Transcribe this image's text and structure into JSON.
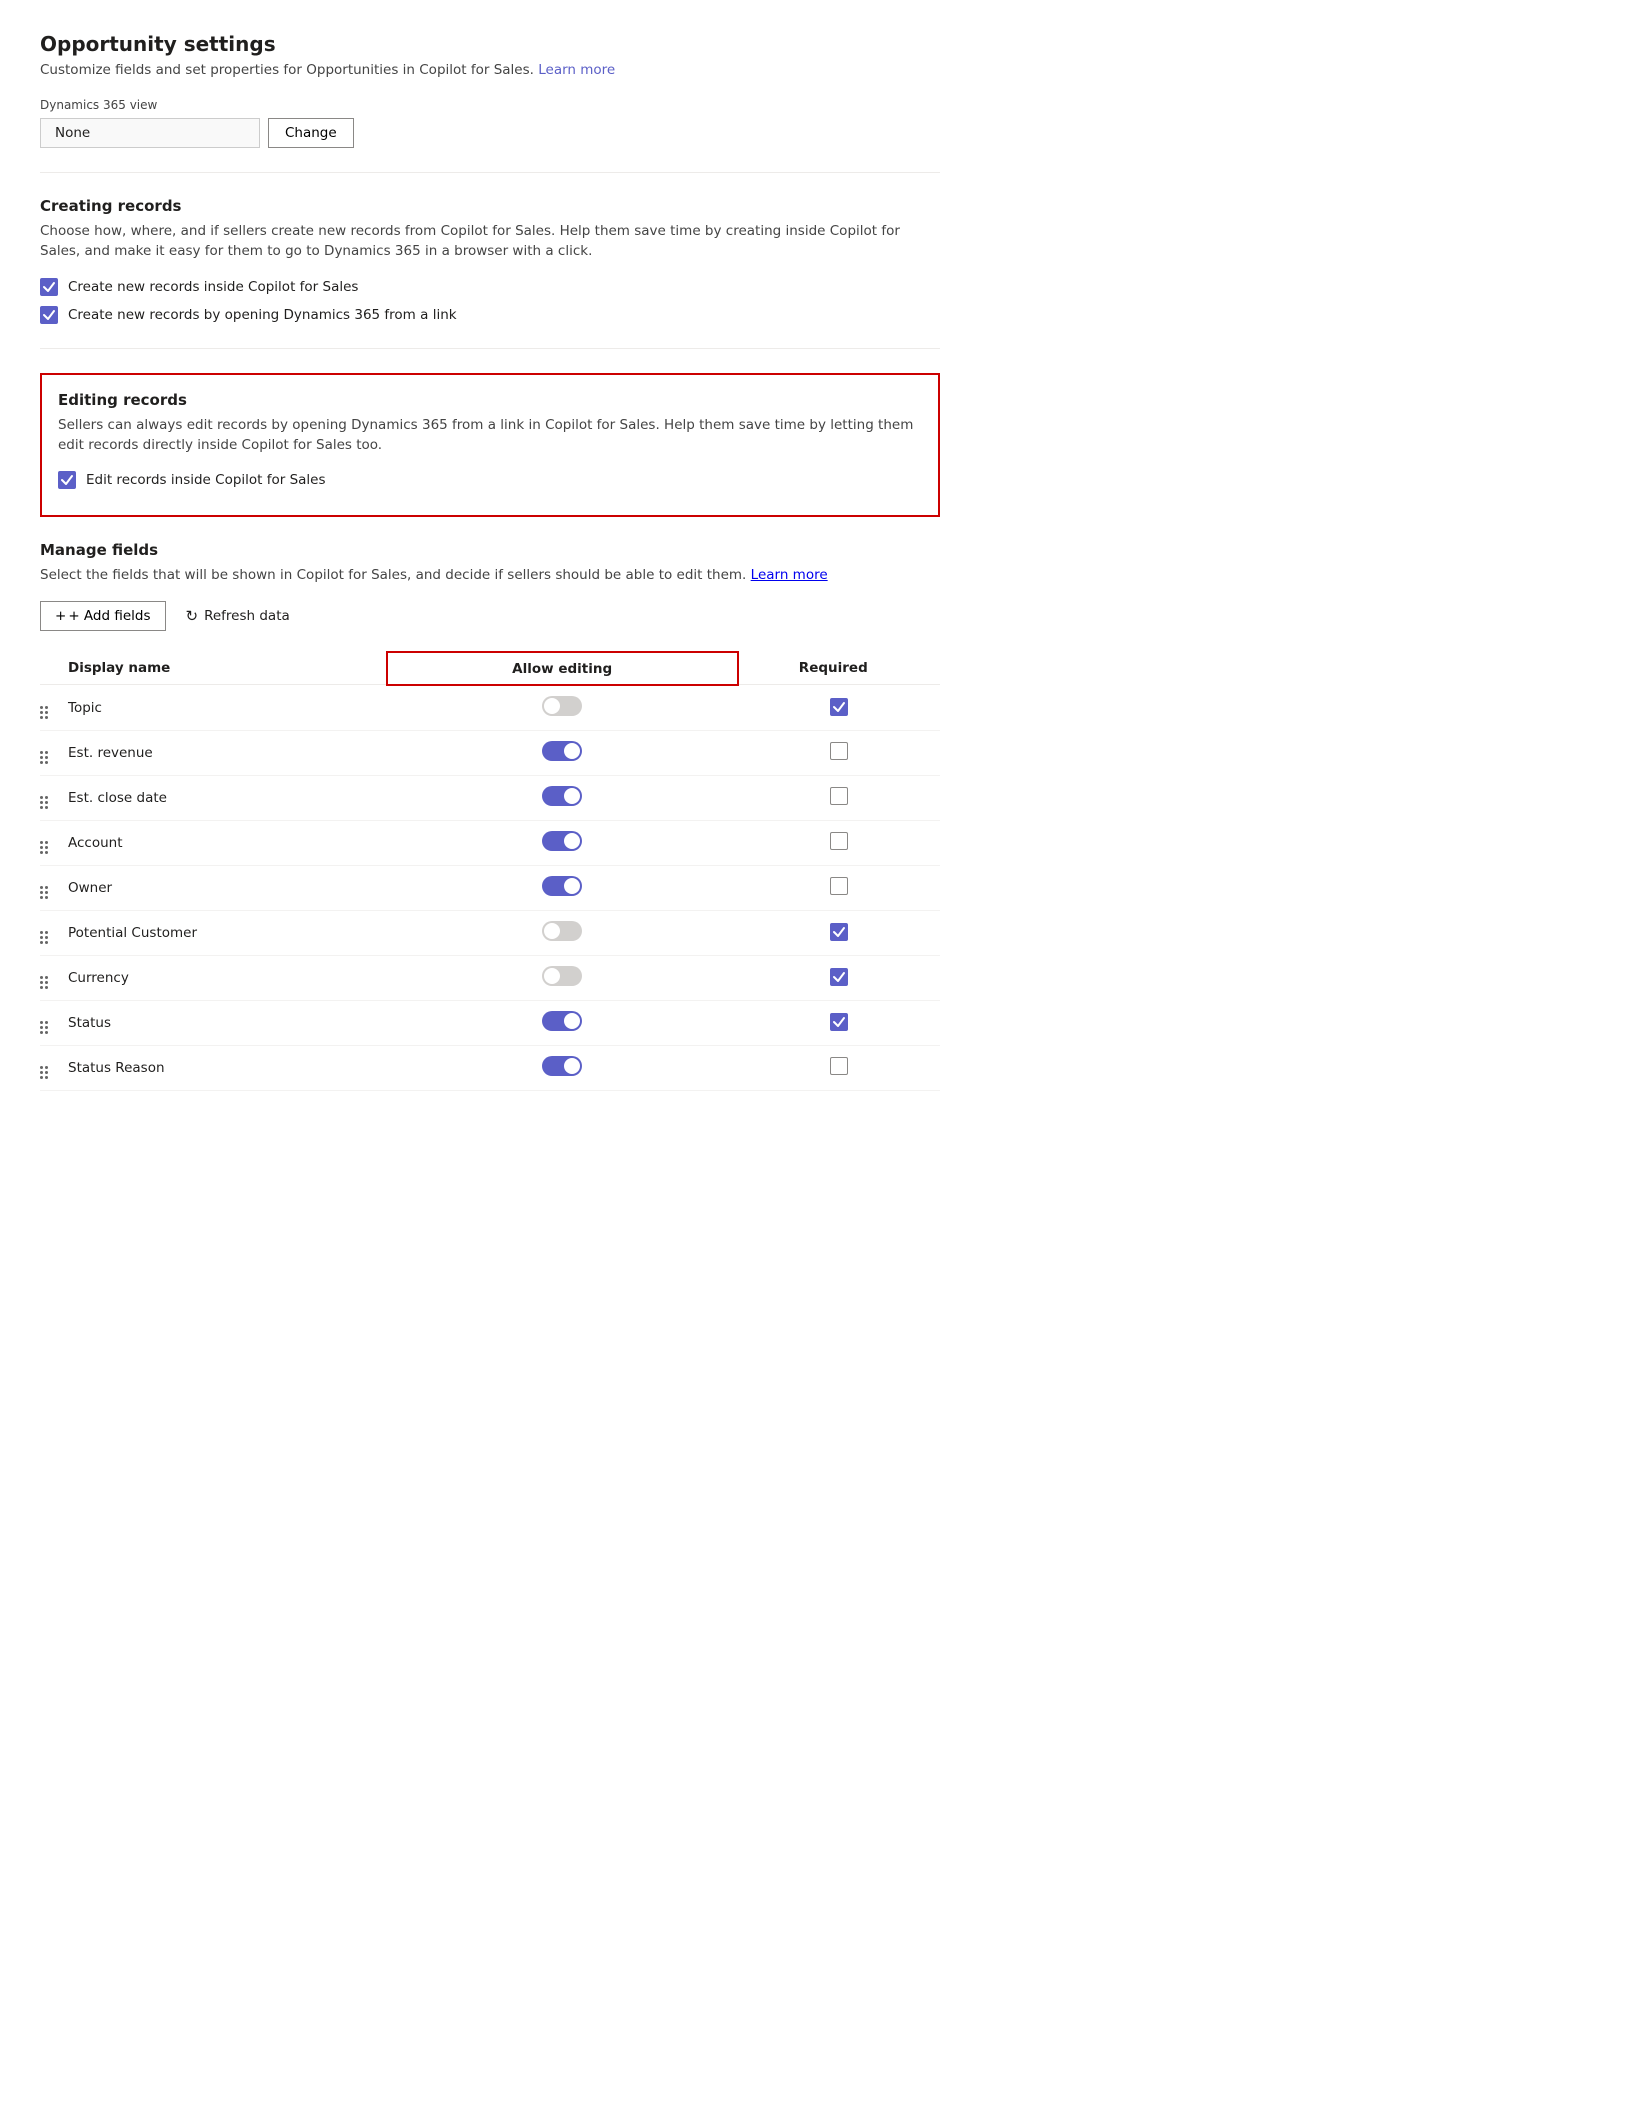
{
  "page": {
    "title": "Opportunity settings",
    "subtitle": "Customize fields and set properties for Opportunities in Copilot for Sales.",
    "learnMoreLink": "Learn more",
    "dynamics365View": {
      "label": "Dynamics 365 view",
      "value": "None",
      "changeButton": "Change"
    }
  },
  "creating_records": {
    "title": "Creating records",
    "description": "Choose how, where, and if sellers create new records from Copilot for Sales. Help them save time by creating inside Copilot for Sales, and make it easy for them to go to Dynamics 365 in a browser with a click.",
    "checkboxes": [
      {
        "id": "cb1",
        "label": "Create new records inside Copilot for Sales",
        "checked": true
      },
      {
        "id": "cb2",
        "label": "Create new records by opening Dynamics 365 from a link",
        "checked": true
      }
    ]
  },
  "editing_records": {
    "title": "Editing records",
    "description": "Sellers can always edit records by opening Dynamics 365 from a link in Copilot for Sales. Help them save time by letting them edit records directly inside Copilot for Sales too.",
    "checkboxes": [
      {
        "id": "cb3",
        "label": "Edit records inside Copilot for Sales",
        "checked": true
      }
    ]
  },
  "manage_fields": {
    "title": "Manage fields",
    "description": "Select the fields that will be shown in Copilot for Sales, and decide if sellers should be able to edit them.",
    "learnMoreLink": "Learn more",
    "addFieldsButton": "+ Add fields",
    "refreshDataButton": "Refresh data",
    "columns": {
      "displayName": "Display name",
      "allowEditing": "Allow editing",
      "required": "Required"
    },
    "fields": [
      {
        "name": "Topic",
        "allowEditing": false,
        "required": true
      },
      {
        "name": "Est. revenue",
        "allowEditing": true,
        "required": false
      },
      {
        "name": "Est. close date",
        "allowEditing": true,
        "required": false
      },
      {
        "name": "Account",
        "allowEditing": true,
        "required": false
      },
      {
        "name": "Owner",
        "allowEditing": true,
        "required": false
      },
      {
        "name": "Potential Customer",
        "allowEditing": false,
        "required": true
      },
      {
        "name": "Currency",
        "allowEditing": false,
        "required": true
      },
      {
        "name": "Status",
        "allowEditing": true,
        "required": true
      },
      {
        "name": "Status Reason",
        "allowEditing": true,
        "required": false
      }
    ]
  }
}
